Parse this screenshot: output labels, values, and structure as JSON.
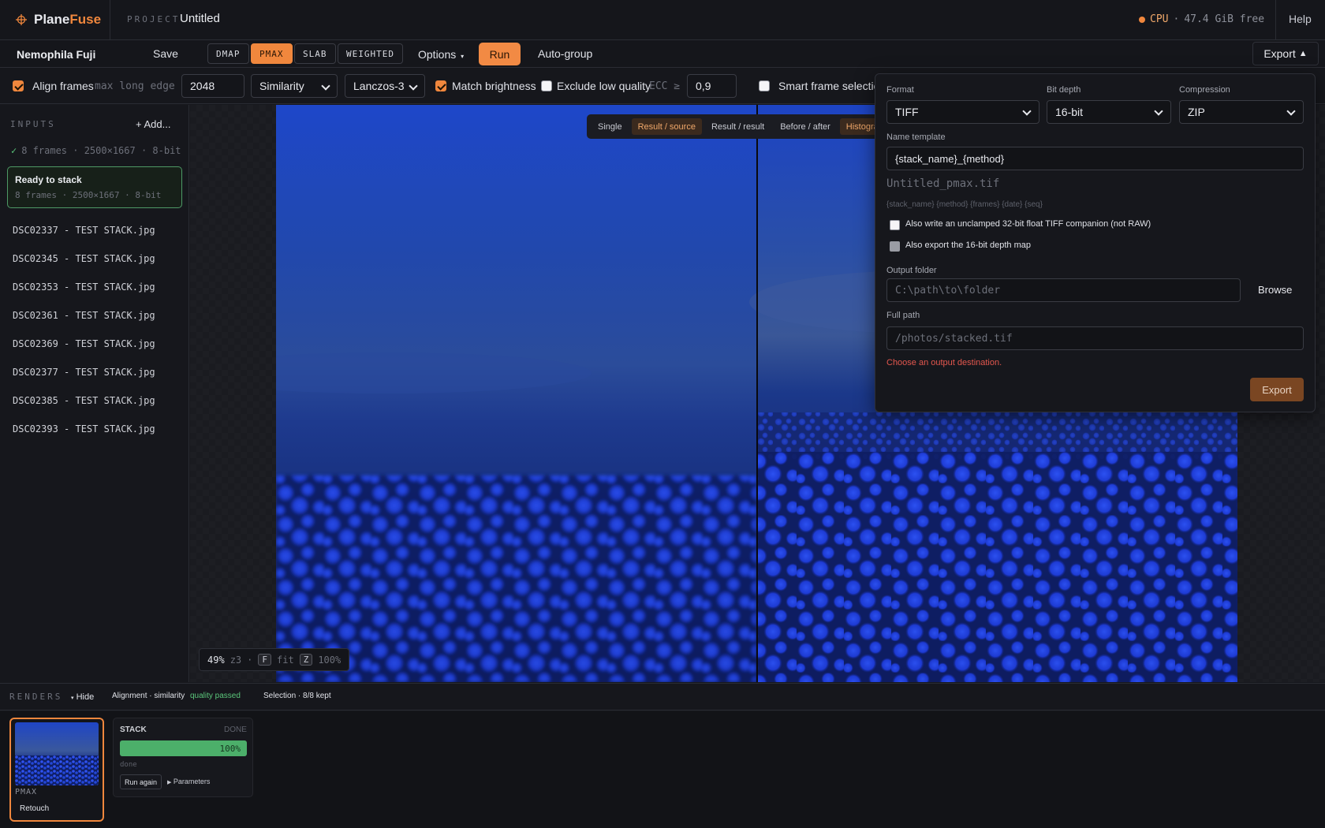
{
  "app": {
    "brand_a": "Plane",
    "brand_b": "Fuse",
    "project_label": "PROJECT",
    "project_name": "Untitled",
    "cpu_label": "CPU",
    "cpu_sep": "·",
    "free": "47.4 GiB free",
    "help": "Help",
    "accent_color": "#f0873d"
  },
  "toolbar": {
    "stack_name": "Nemophila Fuji",
    "save": "Save",
    "methods": [
      "DMAP",
      "PMAX",
      "SLAB",
      "WEIGHTED"
    ],
    "active_method": "PMAX",
    "options": "Options",
    "run": "Run",
    "autogroup": "Auto-group",
    "export": "Export"
  },
  "align": {
    "align_frames": "Align frames",
    "max_long_edge": "max long edge",
    "max_long_edge_value": "2048",
    "transform": "Similarity",
    "resample": "Lanczos-3",
    "match_brightness": "Match brightness",
    "exclude_low_quality": "Exclude low quality",
    "ecc_label": "ECC ≥",
    "ecc_value": "0,9",
    "smart_frame": "Smart frame selection"
  },
  "sidebar": {
    "inputs_label": "INPUTS",
    "add": "+ Add...",
    "summary": "8 frames · 2500×1667 · 8-bit",
    "ready_title": "Ready to stack",
    "ready_sub": "8 frames · 2500×1667 · 8-bit",
    "files": [
      "DSC02337 - TEST STACK.jpg",
      "DSC02345 - TEST STACK.jpg",
      "DSC02353 - TEST STACK.jpg",
      "DSC02361 - TEST STACK.jpg",
      "DSC02369 - TEST STACK.jpg",
      "DSC02377 - TEST STACK.jpg",
      "DSC02385 - TEST STACK.jpg",
      "DSC02393 - TEST STACK.jpg"
    ]
  },
  "viewer": {
    "modes": [
      "Single",
      "Result / source",
      "Result / result",
      "Before / after",
      "Histogram"
    ],
    "active_modes": [
      "Result / source",
      "Histogram"
    ],
    "zoom": "49%",
    "zoom_level": "z3",
    "zoom_sep": "·",
    "key_f": "F",
    "fit": "fit",
    "key_z": "Z",
    "full": "100%"
  },
  "export_panel": {
    "format_label": "Format",
    "format": "TIFF",
    "bit_depth_label": "Bit depth",
    "bit_depth": "16-bit",
    "compression_label": "Compression",
    "compression": "ZIP",
    "name_template_label": "Name template",
    "name_template": "{stack_name}_{method}",
    "preview": "Untitled_pmax.tif",
    "tokens": "{stack_name} {method} {frames} {date} {seq}",
    "opt_float": "Also write an unclamped 32-bit float TIFF companion (not RAW)",
    "opt_depth": "Also export the 16-bit depth map",
    "output_folder_label": "Output folder",
    "output_folder_placeholder": "C:\\path\\to\\folder",
    "browse": "Browse",
    "full_path_label": "Full path",
    "full_path_placeholder": "/photos/stacked.tif",
    "error": "Choose an output destination.",
    "export_btn": "Export",
    "error_color": "#e4574e"
  },
  "renders": {
    "label": "RENDERS",
    "hide": "Hide",
    "alignment": "Alignment · similarity",
    "quality": "quality passed",
    "selection": "Selection · 8/8 kept",
    "render_method": "PMAX",
    "retouch": "Retouch",
    "stack_title": "STACK",
    "stack_status": "DONE",
    "progress": 100,
    "progress_label": "100%",
    "done": "done",
    "run_again": "Run again",
    "parameters": "Parameters"
  }
}
